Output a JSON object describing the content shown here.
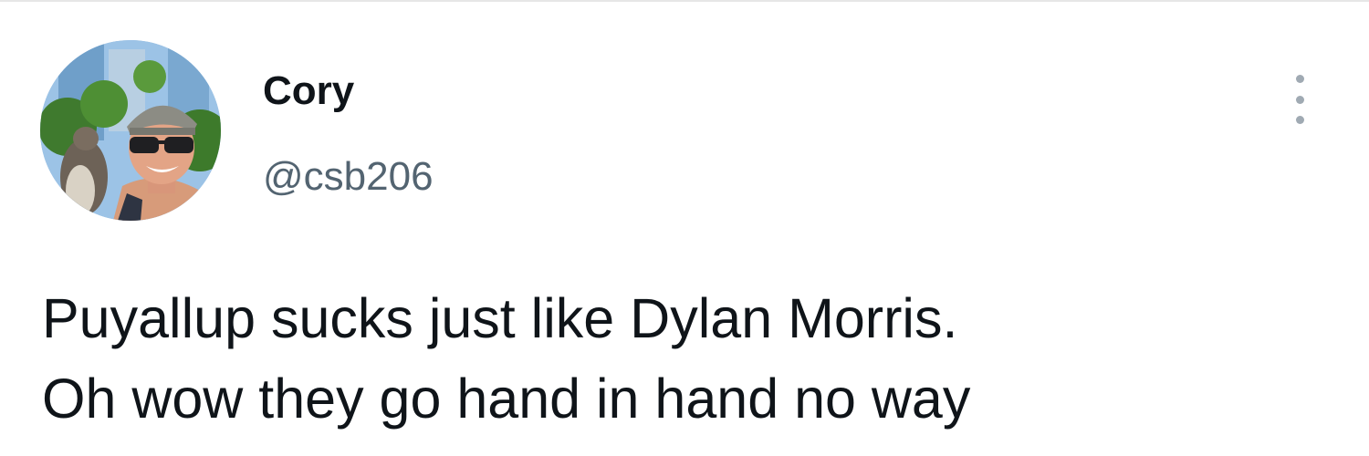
{
  "tweet": {
    "author": {
      "display_name": "Cory",
      "handle": "@csb206"
    },
    "text_lines": [
      "Puyallup sucks just like Dylan Morris.",
      "Oh wow they go hand in hand no way"
    ],
    "more_icon": "more-options-vertical-dots"
  },
  "colors": {
    "text_primary": "#0f1419",
    "text_secondary": "#536471",
    "icon_muted": "#a0aab3",
    "background": "#ffffff"
  }
}
